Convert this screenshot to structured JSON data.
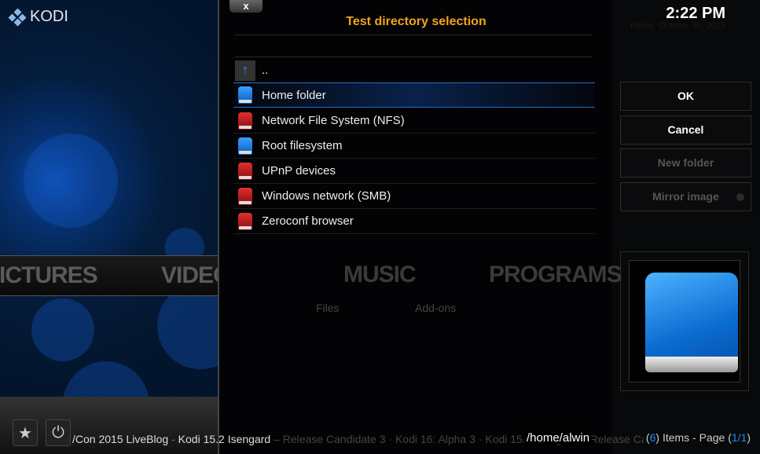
{
  "app": {
    "logo": "KODI"
  },
  "home_menu": {
    "items": [
      "PICTURES",
      "VIDEOS",
      "MUSIC",
      "PROGRAMS"
    ],
    "submenu": [
      "Files",
      "Add-ons"
    ]
  },
  "ticker": {
    "text_a": "/Con 2015 LiveBlog",
    "sep": " - ",
    "text_b": "Kodi 15.2 Isengard",
    "text_c": " – Release Candidate 3 · Kodi 16: Alpha 3 · Kodi 15.2 Isengard – Release Candidate 2 · Kodi"
  },
  "dialog": {
    "title": "Test directory selection",
    "close_label": "x",
    "items": [
      {
        "label": "..",
        "icon": "parent-folder-icon"
      },
      {
        "label": "Home folder",
        "icon": "drive-blue"
      },
      {
        "label": "Network File System (NFS)",
        "icon": "drive-red"
      },
      {
        "label": "Root filesystem",
        "icon": "drive-blue"
      },
      {
        "label": "UPnP devices",
        "icon": "drive-red"
      },
      {
        "label": "Windows network (SMB)",
        "icon": "drive-red"
      },
      {
        "label": "Zeroconf browser",
        "icon": "drive-red"
      }
    ],
    "path": "/home/alwin"
  },
  "side": {
    "time": "2:22 PM",
    "date": "Friday, October 30, 2015",
    "buttons": {
      "ok": "OK",
      "cancel": "Cancel",
      "new_folder": "New folder",
      "mirror": "Mirror image"
    },
    "count": {
      "pre": "(",
      "items": "6",
      "mid": ") Items - Page (",
      "page": "1/1",
      "post": ")"
    }
  },
  "colors": {
    "accent": "#1e8cff",
    "title": "#f0a418"
  }
}
